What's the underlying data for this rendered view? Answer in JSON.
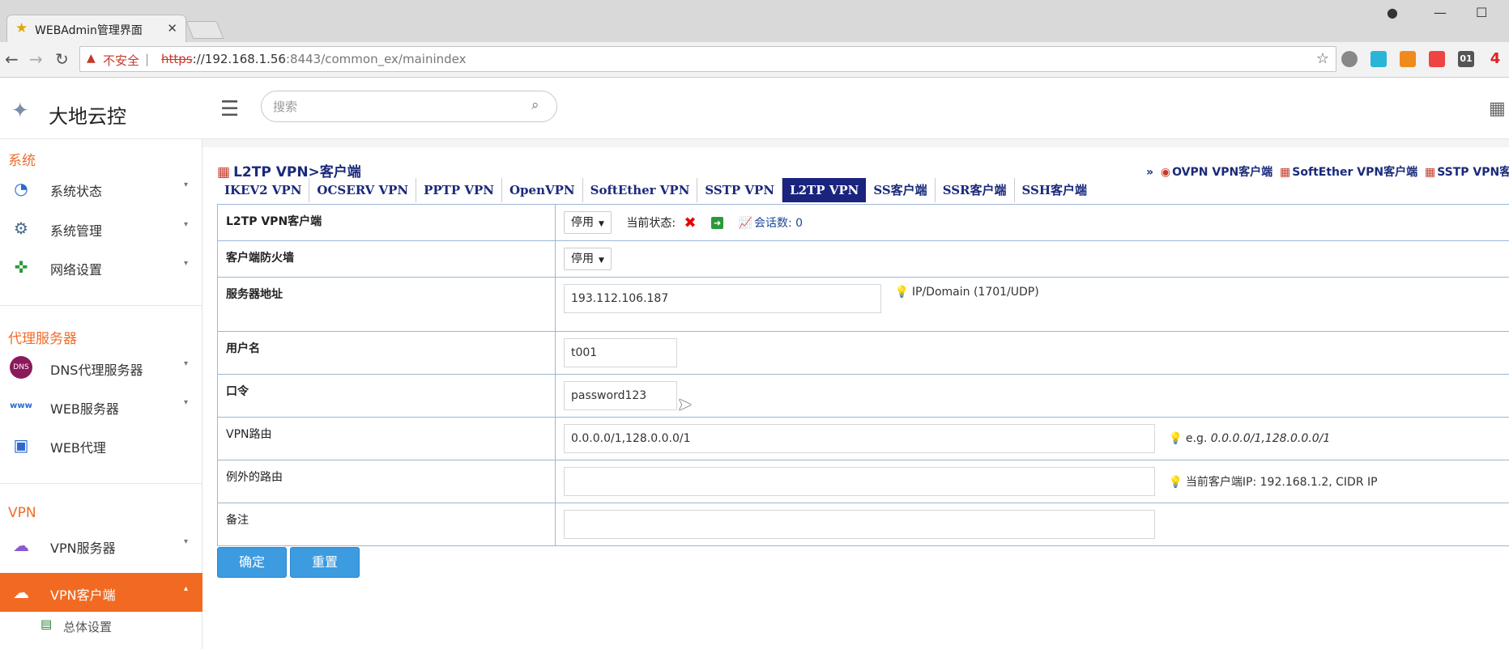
{
  "browser": {
    "tab_title": "WEBAdmin管理界面",
    "url_security": "不安全",
    "url_scheme": "https",
    "url_host": "://192.168.1.56",
    "url_port_path": ":8443/common_ex/mainindex",
    "ext_badge": "4"
  },
  "header": {
    "brand": "大地云控",
    "search_placeholder": "搜索"
  },
  "sidebar": {
    "sections": [
      {
        "title": "系统",
        "items": [
          {
            "label": "系统状态",
            "icon": "dashboard-icon"
          },
          {
            "label": "系统管理",
            "icon": "gears-icon"
          },
          {
            "label": "网络设置",
            "icon": "network-icon"
          }
        ]
      },
      {
        "title": "代理服务器",
        "items": [
          {
            "label": "DNS代理服务器",
            "icon": "dns-icon"
          },
          {
            "label": "WEB服务器",
            "icon": "www-icon"
          },
          {
            "label": "WEB代理",
            "icon": "web-proxy-icon"
          }
        ]
      },
      {
        "title": "VPN",
        "items": [
          {
            "label": "VPN服务器",
            "icon": "vpn-server-icon"
          },
          {
            "label": "VPN客户端",
            "icon": "vpn-client-icon"
          }
        ]
      }
    ],
    "sub_item": "总体设置"
  },
  "page": {
    "title": "L2TP VPN>客户端",
    "right_prefix": "»",
    "right_links": [
      "OVPN VPN客户端",
      "SoftEther VPN客户端",
      "SSTP VPN客户端"
    ],
    "tabs": [
      "IKEV2 VPN",
      "OCSERV VPN",
      "PPTP VPN",
      "OpenVPN",
      "SoftEther VPN",
      "SSTP VPN",
      "L2TP VPN",
      "SS客户端",
      "SSR客户端",
      "SSH客户端"
    ],
    "active_tab": "L2TP VPN"
  },
  "form": {
    "client_label": "L2TP VPN客户端",
    "client_value": "停用",
    "status_label": "当前状态:",
    "sessions_label": "会话数: 0",
    "firewall_label": "客户端防火墙",
    "firewall_value": "停用",
    "server_label": "服务器地址",
    "server_value": "193.112.106.187",
    "server_hint": "IP/Domain   (1701/UDP)",
    "user_label": "用户名",
    "user_value": "t001",
    "pass_label": "口令",
    "pass_value": "password123",
    "route_label": "VPN路由",
    "route_value": "0.0.0.0/1,128.0.0.0/1",
    "route_hint_prefix": "e.g.",
    "route_hint_example": "0.0.0.0/1,128.0.0.0/1",
    "except_label": "例外的路由",
    "except_value": "",
    "except_hint": "当前客户端IP: 192.168.1.2, CIDR IP",
    "note_label": "备注",
    "note_value": "",
    "confirm_button": "确定",
    "reset_button": "重置"
  }
}
